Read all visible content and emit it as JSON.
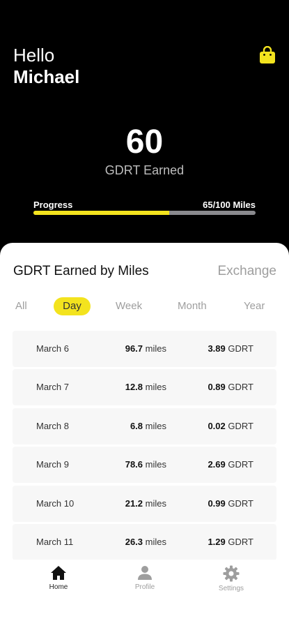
{
  "header": {
    "greeting": "Hello",
    "username": "Michael",
    "earned_value": "60",
    "earned_label": "GDRT Earned",
    "progress_label": "Progress",
    "progress_count": "65/100 Miles",
    "progress_fraction": 0.61,
    "bag_icon": "shopping-bag-icon"
  },
  "panel": {
    "title": "GDRT Earned by Miles",
    "exchange_label": "Exchange",
    "tabs": [
      {
        "label": "All",
        "active": false
      },
      {
        "label": "Day",
        "active": true
      },
      {
        "label": "Week",
        "active": false
      },
      {
        "label": "Month",
        "active": false
      },
      {
        "label": "Year",
        "active": false
      }
    ],
    "rows": [
      {
        "date": "March 6",
        "miles": "96.7",
        "miles_unit": "miles",
        "gdrt": "3.89",
        "gdrt_unit": "GDRT"
      },
      {
        "date": "March 7",
        "miles": "12.8",
        "miles_unit": "miles",
        "gdrt": "0.89",
        "gdrt_unit": "GDRT"
      },
      {
        "date": "March 8",
        "miles": "6.8",
        "miles_unit": "miles",
        "gdrt": "0.02",
        "gdrt_unit": "GDRT"
      },
      {
        "date": "March 9",
        "miles": "78.6",
        "miles_unit": "miles",
        "gdrt": "2.69",
        "gdrt_unit": "GDRT"
      },
      {
        "date": "March 10",
        "miles": "21.2",
        "miles_unit": "miles",
        "gdrt": "0.99",
        "gdrt_unit": "GDRT"
      },
      {
        "date": "March 11",
        "miles": "26.3",
        "miles_unit": "miles",
        "gdrt": "1.29",
        "gdrt_unit": "GDRT"
      }
    ]
  },
  "nav": {
    "items": [
      {
        "label": "Home",
        "icon": "home-icon",
        "active": true
      },
      {
        "label": "Profile",
        "icon": "profile-icon",
        "active": false
      },
      {
        "label": "Settings",
        "icon": "gear-icon",
        "active": false
      }
    ]
  },
  "colors": {
    "accent": "#f3e31e",
    "background": "#000000",
    "panel": "#ffffff",
    "muted": "#9e9e9e"
  }
}
